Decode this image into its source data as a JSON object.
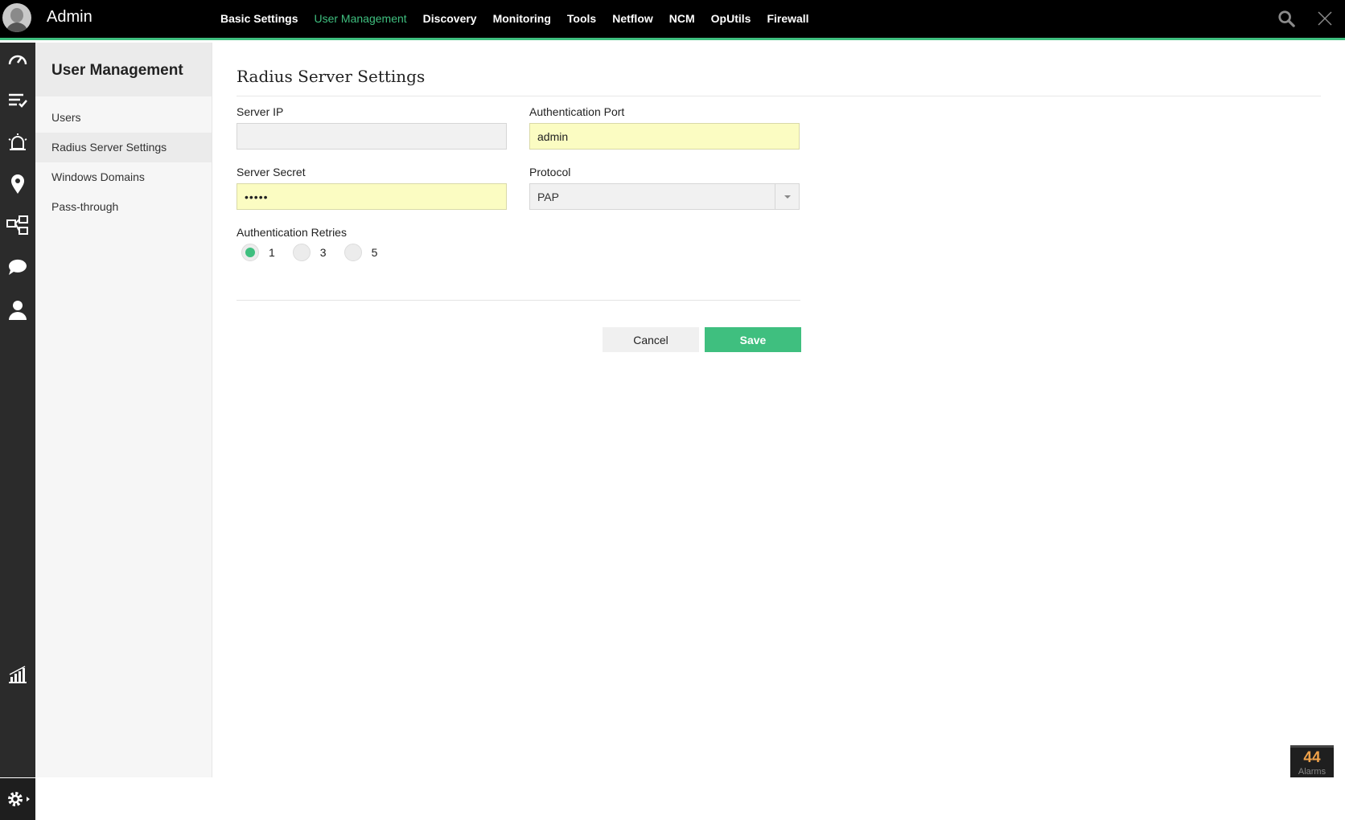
{
  "header": {
    "title": "Admin",
    "nav": [
      {
        "label": "Basic Settings",
        "active": false
      },
      {
        "label": "User Management",
        "active": true
      },
      {
        "label": "Discovery",
        "active": false
      },
      {
        "label": "Monitoring",
        "active": false
      },
      {
        "label": "Tools",
        "active": false
      },
      {
        "label": "Netflow",
        "active": false
      },
      {
        "label": "NCM",
        "active": false
      },
      {
        "label": "OpUtils",
        "active": false
      },
      {
        "label": "Firewall",
        "active": false
      }
    ],
    "accent_color": "#3fbf7f"
  },
  "rail": {
    "icons": [
      "dashboard-icon",
      "inventory-icon",
      "alarm-icon",
      "map-icon",
      "workflow-icon",
      "chat-icon",
      "user-icon",
      "reports-icon",
      "settings-icon"
    ]
  },
  "subnav": {
    "title": "User Management",
    "items": [
      {
        "label": "Users",
        "active": false
      },
      {
        "label": "Radius Server Settings",
        "active": true
      },
      {
        "label": "Windows Domains",
        "active": false
      },
      {
        "label": "Pass-through",
        "active": false
      }
    ]
  },
  "form": {
    "title": "Radius Server Settings",
    "server_ip": {
      "label": "Server IP",
      "value": ""
    },
    "auth_port": {
      "label": "Authentication Port",
      "value": "admin"
    },
    "server_secret": {
      "label": "Server Secret",
      "value": "•••••"
    },
    "protocol": {
      "label": "Protocol",
      "value": "PAP"
    },
    "retries": {
      "label": "Authentication Retries",
      "options": [
        "1",
        "3",
        "5"
      ],
      "selected": "1"
    },
    "cancel_label": "Cancel",
    "save_label": "Save"
  },
  "alarms": {
    "count": "44",
    "label": "Alarms"
  }
}
